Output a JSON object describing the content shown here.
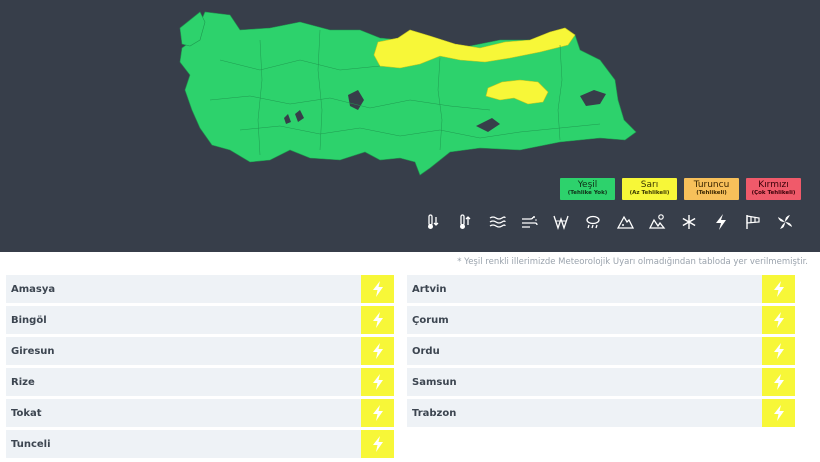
{
  "legend": [
    {
      "name": "Yeşil",
      "sub": "(Tehlike Yok)",
      "color": "#2dd26c"
    },
    {
      "name": "Sarı",
      "sub": "(Az Tehlikeli)",
      "color": "#f7f738"
    },
    {
      "name": "Turuncu",
      "sub": "(Tehlikeli)",
      "color": "#f7c05a"
    },
    {
      "name": "Kırmızı",
      "sub": "(Çok Tehlikeli)",
      "color": "#f05a6a"
    }
  ],
  "hazard_icons": [
    "cold-temperature-icon",
    "hot-temperature-icon",
    "fog-icon",
    "dust-wind-icon",
    "strong-wind-icon",
    "heavy-rain-icon",
    "avalanche-icon",
    "hail-icon",
    "snow-icon",
    "lightning-icon",
    "windsock-icon",
    "storm-icon"
  ],
  "note": "* Yeşil renkli illerimizde Meteorolojik Uyarı olmadığından tabloda yer verilmemiştir.",
  "warnings": {
    "left": [
      "Amasya",
      "Bingöl",
      "Giresun",
      "Rize",
      "Tokat",
      "Tunceli"
    ],
    "right": [
      "Artvin",
      "Çorum",
      "Ordu",
      "Samsun",
      "Trabzon"
    ]
  },
  "warning_level_color": "#f7f738",
  "warning_icon": "lightning-icon"
}
